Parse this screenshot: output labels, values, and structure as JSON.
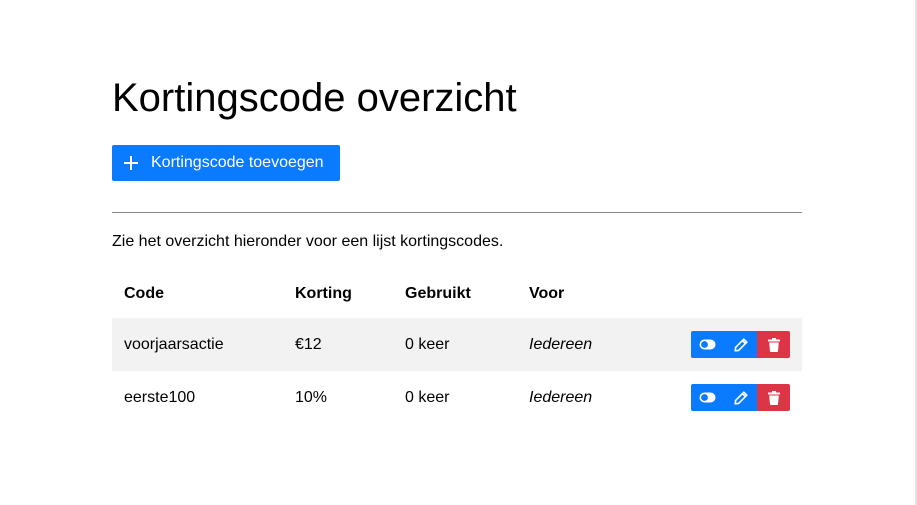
{
  "page": {
    "title": "Kortingscode overzicht",
    "add_button_label": "Kortingscode toevoegen",
    "intro": "Zie het overzicht hieronder voor een lijst kortingscodes."
  },
  "table": {
    "headers": {
      "code": "Code",
      "korting": "Korting",
      "gebruikt": "Gebruikt",
      "voor": "Voor"
    },
    "rows": [
      {
        "code": "voorjaarsactie",
        "korting": "€12",
        "gebruikt": "0 keer",
        "voor": "Iedereen"
      },
      {
        "code": "eerste100",
        "korting": "10%",
        "gebruikt": "0 keer",
        "voor": "Iedereen"
      }
    ],
    "row_actions": [
      "toggle-icon",
      "pencil-icon",
      "trash-icon"
    ]
  },
  "colors": {
    "primary": "#0a7bff",
    "danger": "#dc3545",
    "stripe": "#f2f2f2"
  }
}
